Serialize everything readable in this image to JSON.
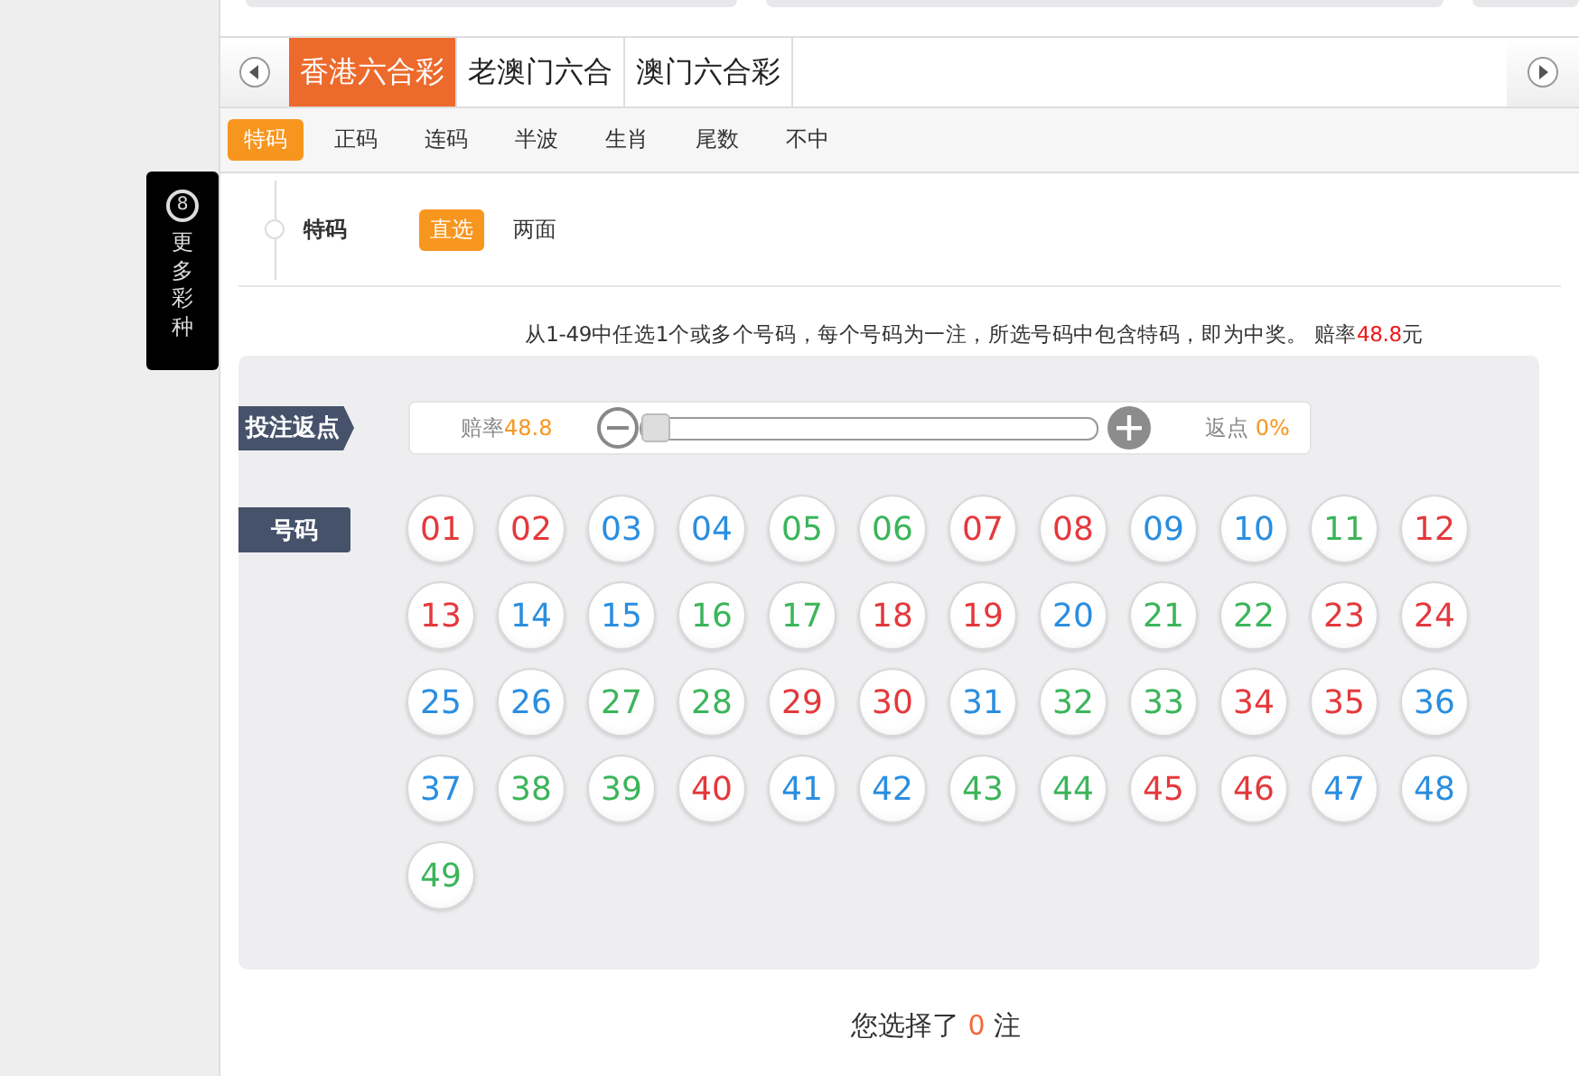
{
  "lottery_tabs": [
    {
      "label": "香港六合彩",
      "selected": true
    },
    {
      "label": "老澳门六合",
      "selected": false
    },
    {
      "label": "澳门六合彩",
      "selected": false
    }
  ],
  "play_tabs": [
    {
      "label": "特码",
      "selected": true
    },
    {
      "label": "正码",
      "selected": false
    },
    {
      "label": "连码",
      "selected": false
    },
    {
      "label": "半波",
      "selected": false
    },
    {
      "label": "生肖",
      "selected": false
    },
    {
      "label": "尾数",
      "selected": false
    },
    {
      "label": "不中",
      "selected": false
    }
  ],
  "side_panel": {
    "badge": "8",
    "label": "更多彩种"
  },
  "mode": {
    "title": "特码",
    "options": [
      {
        "label": "直选",
        "selected": true
      },
      {
        "label": "两面",
        "selected": false
      }
    ]
  },
  "rule": {
    "text": "从1-49中任选1个或多个号码，每个号码为一注，所选号码中包含特码，即为中奖。 赔率",
    "odds": "48.8",
    "unit": "元"
  },
  "rebate": {
    "label": "投注返点",
    "odds_label": "赔率",
    "odds_value": "48.8",
    "level": 0,
    "rebate_label": "返点",
    "rebate_value": "0%"
  },
  "numbers": {
    "label": "号码",
    "balls": [
      {
        "n": "01",
        "color": "#e4393c"
      },
      {
        "n": "02",
        "color": "#e4393c"
      },
      {
        "n": "03",
        "color": "#2a8ee0"
      },
      {
        "n": "04",
        "color": "#2a8ee0"
      },
      {
        "n": "05",
        "color": "#3cb55a"
      },
      {
        "n": "06",
        "color": "#3cb55a"
      },
      {
        "n": "07",
        "color": "#e4393c"
      },
      {
        "n": "08",
        "color": "#e4393c"
      },
      {
        "n": "09",
        "color": "#2a8ee0"
      },
      {
        "n": "10",
        "color": "#2a8ee0"
      },
      {
        "n": "11",
        "color": "#3cb55a"
      },
      {
        "n": "12",
        "color": "#e4393c"
      },
      {
        "n": "13",
        "color": "#e4393c"
      },
      {
        "n": "14",
        "color": "#2a8ee0"
      },
      {
        "n": "15",
        "color": "#2a8ee0"
      },
      {
        "n": "16",
        "color": "#3cb55a"
      },
      {
        "n": "17",
        "color": "#3cb55a"
      },
      {
        "n": "18",
        "color": "#e4393c"
      },
      {
        "n": "19",
        "color": "#e4393c"
      },
      {
        "n": "20",
        "color": "#2a8ee0"
      },
      {
        "n": "21",
        "color": "#3cb55a"
      },
      {
        "n": "22",
        "color": "#3cb55a"
      },
      {
        "n": "23",
        "color": "#e4393c"
      },
      {
        "n": "24",
        "color": "#e4393c"
      },
      {
        "n": "25",
        "color": "#2a8ee0"
      },
      {
        "n": "26",
        "color": "#2a8ee0"
      },
      {
        "n": "27",
        "color": "#3cb55a"
      },
      {
        "n": "28",
        "color": "#3cb55a"
      },
      {
        "n": "29",
        "color": "#e4393c"
      },
      {
        "n": "30",
        "color": "#e4393c"
      },
      {
        "n": "31",
        "color": "#2a8ee0"
      },
      {
        "n": "32",
        "color": "#3cb55a"
      },
      {
        "n": "33",
        "color": "#3cb55a"
      },
      {
        "n": "34",
        "color": "#e4393c"
      },
      {
        "n": "35",
        "color": "#e4393c"
      },
      {
        "n": "36",
        "color": "#2a8ee0"
      },
      {
        "n": "37",
        "color": "#2a8ee0"
      },
      {
        "n": "38",
        "color": "#3cb55a"
      },
      {
        "n": "39",
        "color": "#3cb55a"
      },
      {
        "n": "40",
        "color": "#e4393c"
      },
      {
        "n": "41",
        "color": "#2a8ee0"
      },
      {
        "n": "42",
        "color": "#2a8ee0"
      },
      {
        "n": "43",
        "color": "#3cb55a"
      },
      {
        "n": "44",
        "color": "#3cb55a"
      },
      {
        "n": "45",
        "color": "#e4393c"
      },
      {
        "n": "46",
        "color": "#e4393c"
      },
      {
        "n": "47",
        "color": "#2a8ee0"
      },
      {
        "n": "48",
        "color": "#2a8ee0"
      },
      {
        "n": "49",
        "color": "#3cb55a"
      }
    ]
  },
  "summary": {
    "before": "您选择了",
    "count": "0",
    "after": "注"
  }
}
